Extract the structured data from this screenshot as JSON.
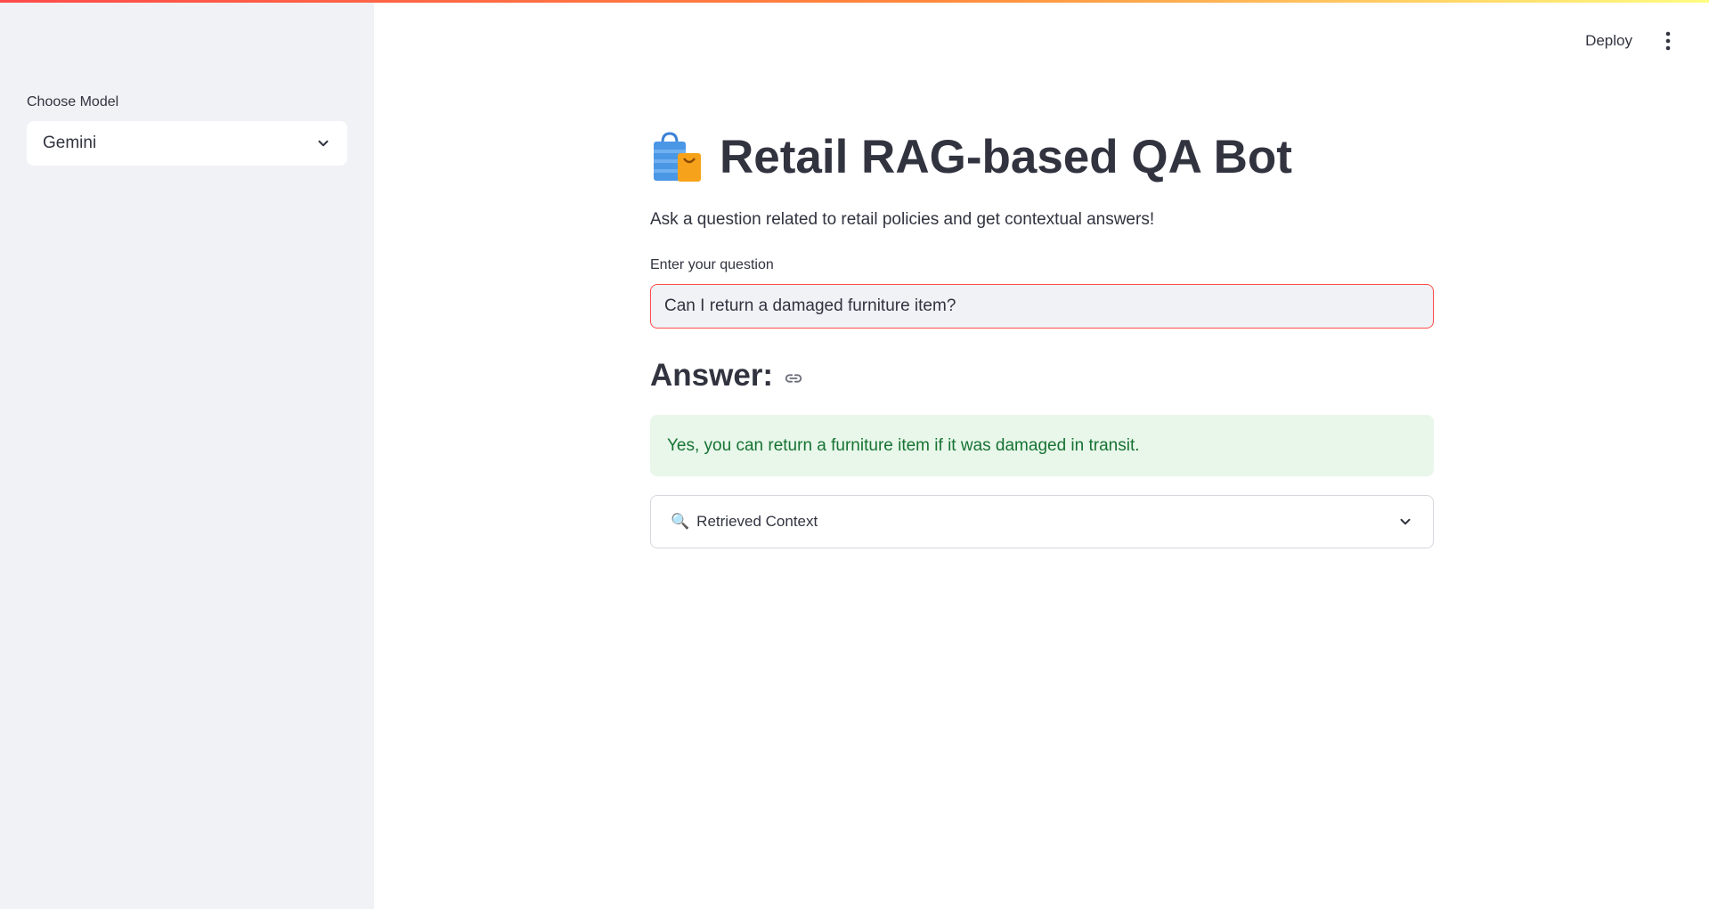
{
  "sidebar": {
    "model_label": "Choose Model",
    "model_value": "Gemini"
  },
  "header": {
    "deploy_label": "Deploy"
  },
  "main": {
    "title_emoji": "🛍️",
    "title": "Retail RAG-based QA Bot",
    "subtitle": "Ask a question related to retail policies and get contextual answers!",
    "question_label": "Enter your question",
    "question_value": "Can I return a damaged furniture item?",
    "answer_heading": "Answer:",
    "answer_text": "Yes, you can return a furniture item if it was damaged in transit.",
    "context_icon": "🔍",
    "context_label": "Retrieved Context"
  },
  "colors": {
    "accent_red": "#ff4b4b",
    "success_bg": "#e8f7ea",
    "success_text": "#177233",
    "sidebar_bg": "#f0f2f6"
  }
}
